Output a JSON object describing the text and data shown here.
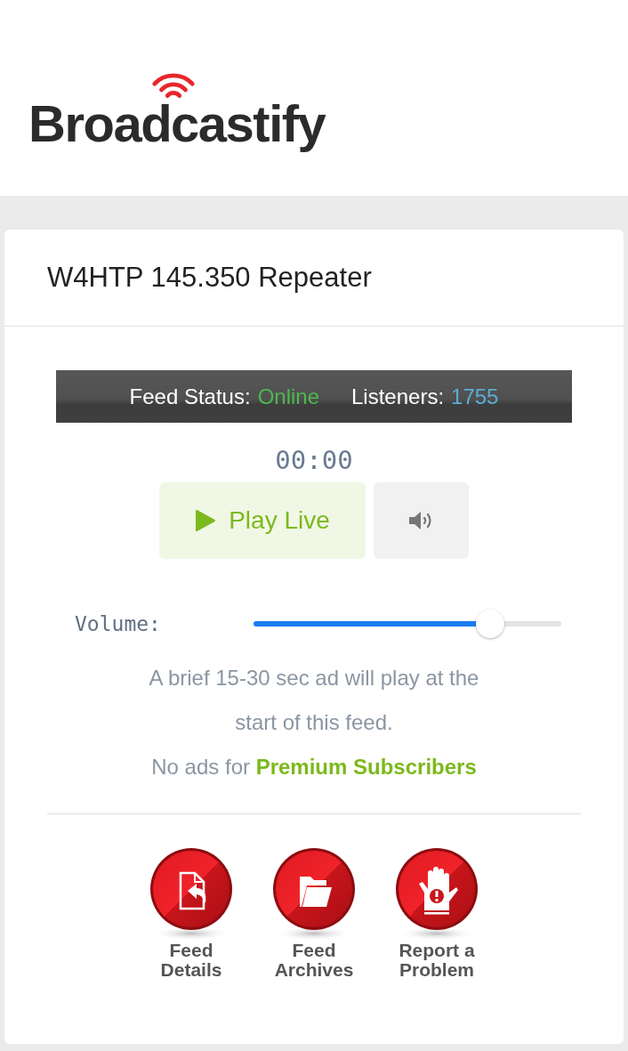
{
  "header": {
    "logo": "Broadcastify"
  },
  "feed": {
    "title": "W4HTP 145.350 Repeater",
    "status_bar": {
      "status_label": "Feed Status:",
      "status_value": "Online",
      "listeners_label": "Listeners:",
      "listeners_value": "1755"
    },
    "timer": "00:00",
    "play_button": "Play Live",
    "volume": {
      "label": "Volume:",
      "level": 0.77
    },
    "ad_notice": "A brief 15-30 sec ad will play at the start of this feed.",
    "premium_note": {
      "text": "No ads for",
      "link": "Premium Subscribers"
    },
    "links": [
      {
        "kind": "details",
        "label": "Feed Details"
      },
      {
        "kind": "archives",
        "label": "Feed Archives"
      },
      {
        "kind": "report",
        "label": "Report a Problem"
      }
    ]
  }
}
